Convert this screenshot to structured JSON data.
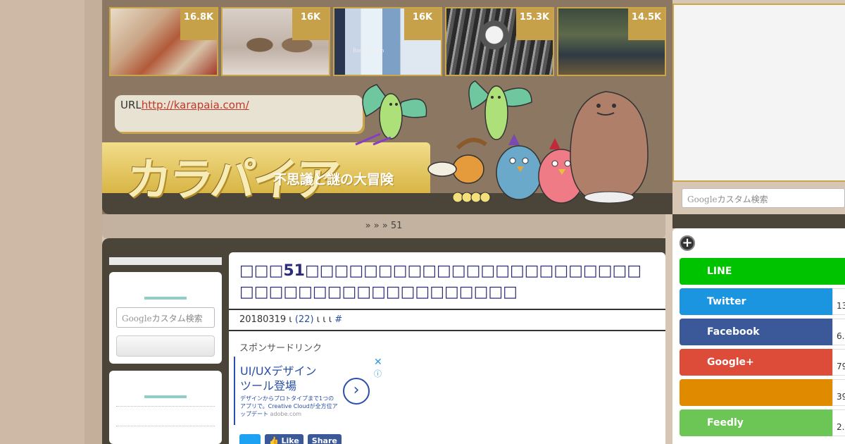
{
  "thumbs": [
    {
      "count": "16.8K",
      "name": "thumb-egypt"
    },
    {
      "count": "16K",
      "name": "thumb-sparrows"
    },
    {
      "count": "16K",
      "name": "thumb-lighthouse",
      "overlay": "Ron Acuwan"
    },
    {
      "count": "15.3K",
      "name": "thumb-monkey"
    },
    {
      "count": "14.5K",
      "name": "thumb-market"
    }
  ],
  "header": {
    "url_label": "URL",
    "url": "http://karapaia.com/",
    "logo": "カラパイア",
    "tagline": "不思議と謎の大冒険"
  },
  "breadcrumb": {
    "text": "»   »        » 51"
  },
  "left_sidebar": {
    "search_placeholder_brand": "Google",
    "search_placeholder_text": "カスタム検索"
  },
  "article": {
    "title": "□□□51□□□□□□□□□□□□□□□□□□□□□□□□□□□□□□□□□□□□□□□□□□",
    "meta_date": "20180319 ι ",
    "meta_comments": "(22)",
    "meta_rest": " ι  ι        ι ",
    "meta_hash": "#",
    "sponsor": "スポンサードリンク",
    "ad": {
      "title": "UI/UXデザイン\nツール登場",
      "body": "デザインからプロトタイプまで1つのアプリで。Creative Cloudが全方位アップデート",
      "domain": "adobe.com",
      "arrow": "›",
      "close": "✕",
      "info": "ⓘ"
    },
    "share": {
      "like": "Like",
      "share": "Share"
    }
  },
  "right": {
    "search_brand": "Google",
    "search_text": "カスタム検索",
    "plus": "+",
    "buttons": [
      {
        "name": "line-button",
        "label": "LINE",
        "count": "",
        "color": "#00c300"
      },
      {
        "name": "twitter-button",
        "label": "Twitter",
        "count": "13",
        "color": "#1b95e0"
      },
      {
        "name": "facebook-button",
        "label": "Facebook",
        "count": "6.",
        "color": "#3b5998"
      },
      {
        "name": "googleplus-button",
        "label": "Google+",
        "count": "79",
        "color": "#dd4b39"
      },
      {
        "name": "hatena-button",
        "label": "",
        "count": "39",
        "color": "#e08a00"
      },
      {
        "name": "feedly-button",
        "label": "Feedly",
        "count": "2.",
        "color": "#6cc655"
      }
    ]
  }
}
